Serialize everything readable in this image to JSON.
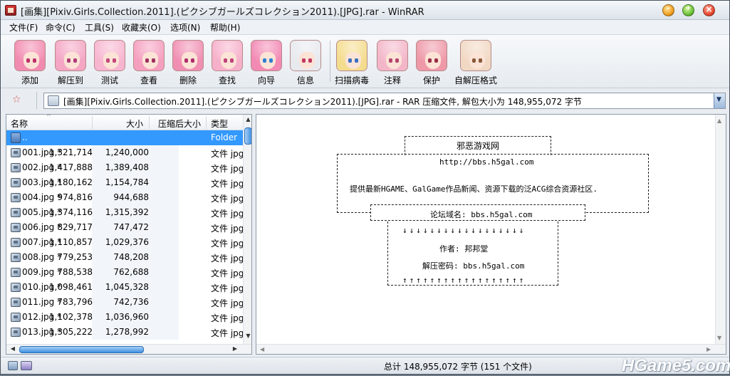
{
  "window": {
    "title": "[画集][Pixiv.Girls.Collection.2011].(ピクシブガールズコレクション2011).[JPG].rar - WinRAR"
  },
  "menu": [
    "文件(F)",
    "命令(C)",
    "工具(S)",
    "收藏夹(O)",
    "选项(N)",
    "帮助(H)"
  ],
  "toolbar": [
    {
      "label": "添加",
      "hair": "#f28bb0",
      "eye": "#c0306a"
    },
    {
      "label": "解压到",
      "hair": "#f4a6c3",
      "eye": "#b13a78"
    },
    {
      "label": "测试",
      "hair": "#f7b5cf",
      "eye": "#c5457c"
    },
    {
      "label": "查看",
      "hair": "#f59fbf",
      "eye": "#a0305e"
    },
    {
      "label": "删除",
      "hair": "#f08fb2",
      "eye": "#b02d6a"
    },
    {
      "label": "查找",
      "hair": "#f6b0ca",
      "eye": "#c04378"
    },
    {
      "label": "向导",
      "hair": "#f28ab4",
      "eye": "#2f7fd0"
    },
    {
      "label": "信息",
      "hair": "#e7e9ee",
      "eye": "#c0395f"
    },
    {
      "label": "扫描病毒",
      "hair": "#f4dc8e",
      "eye": "#3a6fc0"
    },
    {
      "label": "注释",
      "hair": "#f3b6c9",
      "eye": "#b4456e"
    },
    {
      "label": "保护",
      "hair": "#ee98a8",
      "eye": "#9b2d45"
    },
    {
      "label": "自解压格式",
      "hair": "#f1d8c3",
      "eye": "#8a5a3a"
    }
  ],
  "address": {
    "text": "[画集][Pixiv.Girls.Collection.2011].(ピクシブガールズコレクション2011).[JPG].rar - RAR 压缩文件, 解包大小为 148,955,072 字节"
  },
  "columns": {
    "name": "名称",
    "size": "大小",
    "packed": "压缩后大小",
    "type": "类型"
  },
  "files": [
    {
      "name": "..",
      "size": "",
      "packed": "",
      "type": "Folder",
      "selected": true,
      "folder": true
    },
    {
      "name": "001.jpg *",
      "size": "1,321,714",
      "packed": "1,240,000",
      "type": "文件 jpg"
    },
    {
      "name": "002.jpg *",
      "size": "1,417,888",
      "packed": "1,389,408",
      "type": "文件 jpg"
    },
    {
      "name": "003.jpg *",
      "size": "1,180,162",
      "packed": "1,154,784",
      "type": "文件 jpg"
    },
    {
      "name": "004.jpg *",
      "size": "974,816",
      "packed": "944,688",
      "type": "文件 jpg"
    },
    {
      "name": "005.jpg *",
      "size": "1,374,116",
      "packed": "1,315,392",
      "type": "文件 jpg"
    },
    {
      "name": "006.jpg *",
      "size": "829,717",
      "packed": "747,472",
      "type": "文件 jpg"
    },
    {
      "name": "007.jpg *",
      "size": "1,110,857",
      "packed": "1,029,376",
      "type": "文件 jpg"
    },
    {
      "name": "008.jpg *",
      "size": "779,253",
      "packed": "748,208",
      "type": "文件 jpg"
    },
    {
      "name": "009.jpg *",
      "size": "788,538",
      "packed": "762,688",
      "type": "文件 jpg"
    },
    {
      "name": "010.jpg *",
      "size": "1,098,461",
      "packed": "1,045,328",
      "type": "文件 jpg"
    },
    {
      "name": "011.jpg *",
      "size": "783,796",
      "packed": "742,736",
      "type": "文件 jpg"
    },
    {
      "name": "012.jpg *",
      "size": "1,102,378",
      "packed": "1,036,960",
      "type": "文件 jpg"
    },
    {
      "name": "013.jpg *",
      "size": "1,305,222",
      "packed": "1,278,992",
      "type": "文件 jpg"
    }
  ],
  "preview": {
    "site_name": "邪恶游戏网",
    "site_url": "http://bbs.h5gal.com",
    "description": "提供最新HGAME、GalGame作品新闻、资源下载的泛ACG综合资源社区.",
    "forum_domain": "论坛域名: bbs.h5gal.com",
    "author": "作者: 邦邦堂",
    "password": "解压密码:  bbs.h5gal.com",
    "arrow_down": "↓↓↓↓↓↓↓↓↓↓↓↓↓↓↓↓↓↓",
    "arrow_up": "↑↑↑↑↑↑↑↑↑↑↑↑↑↑↑↑↑↑"
  },
  "status": {
    "total": "总计 148,955,072 字节 (151 个文件)",
    "watermark": "HGame5.com"
  },
  "colors": {
    "selection": "#3399ff",
    "window_bg": "#e9edf2"
  }
}
